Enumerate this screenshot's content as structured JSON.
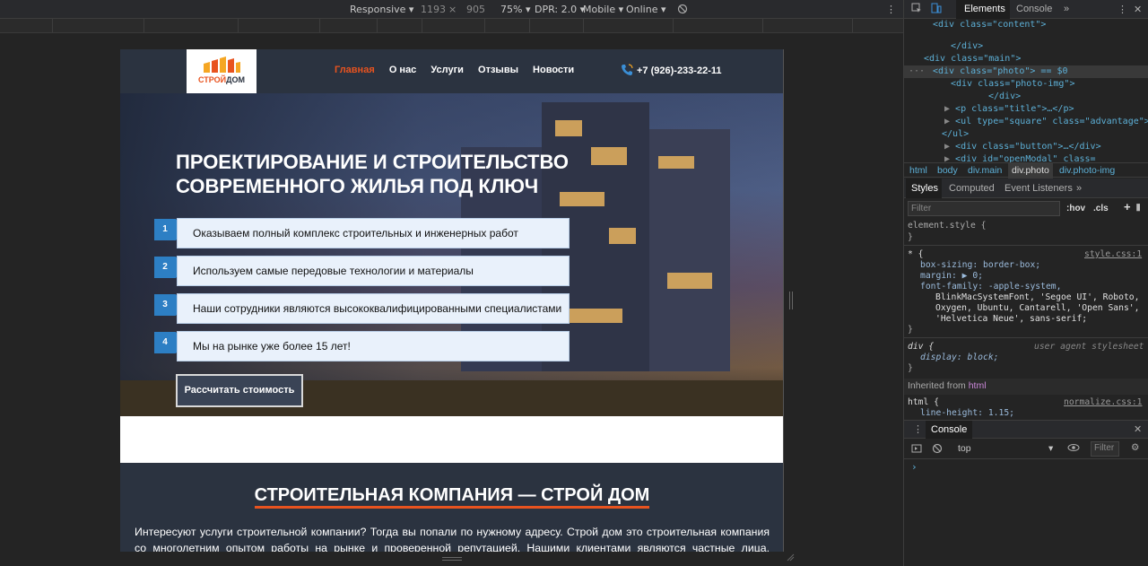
{
  "toolbar": {
    "device": "Responsive",
    "width": "1193",
    "times": "×",
    "height": "905",
    "zoom": "75%",
    "dpr": "DPR: 2.0",
    "mode": "Mobile",
    "network": "Online"
  },
  "site": {
    "logo_top": "СТРОЙ",
    "logo_bottom": "ДОМ",
    "nav": [
      "Главная",
      "О нас",
      "Услуги",
      "Отзывы",
      "Новости"
    ],
    "phone": "+7 (926)-233-22-11",
    "hero_title_line1": "ПРОЕКТИРОВАНИЕ И СТРОИТЕЛЬСТВО",
    "hero_title_line2": "СОВРЕМЕННОГО ЖИЛЬЯ ПОД КЛЮЧ",
    "advantages": [
      {
        "num": "1",
        "text": "Оказываем полный комплекс строительных и инженерных работ"
      },
      {
        "num": "2",
        "text": "Используем самые передовые технологии и материалы"
      },
      {
        "num": "3",
        "text": "Наши сотрудники являются высококвалифицированными специалистами"
      },
      {
        "num": "4",
        "text": "Мы на рынке уже более 15 лет!"
      }
    ],
    "calc_button": "Рассчитать стоимость",
    "section_title": "СТРОИТЕЛЬНАЯ КОМПАНИЯ — СТРОЙ ДОМ",
    "section_text": "Интересуют услуги строительной компании? Тогда вы попали по нужному адресу. Строй дом это строительная компания со многолетним опытом работы на рынке и проверенной репутацией. Нашими клиентами являются частные лица, небольшие"
  },
  "devtools": {
    "tabs": [
      "Elements",
      "Console"
    ],
    "dom_lines": [
      "<div class=\"content\">",
      "</div>",
      "<div class=\"main\">",
      "<div class=\"photo\"> == $0",
      "<div class=\"photo-img\">",
      "</div>",
      "<p class=\"title\">…</p>",
      "<ul type=\"square\" class=\"advantage\">",
      "</ul>",
      "<div class=\"button\">…</div>",
      "<div id=\"openModal\" class="
    ],
    "breadcrumbs": [
      "html",
      "body",
      "div.main",
      "div.photo",
      "div.photo-img"
    ],
    "style_tabs": [
      "Styles",
      "Computed",
      "Event Listeners"
    ],
    "filter_placeholder": "Filter",
    "hov": ":hov",
    "cls": ".cls",
    "element_style": "element.style {",
    "close_brace": "}",
    "rule_star": "* {",
    "src_style": "style.css:1",
    "box_sizing": "box-sizing: border-box;",
    "margin": "margin: ▶ 0;",
    "font_family_1": "font-family: -apple-system,",
    "font_family_2": "BlinkMacSystemFont, 'Segoe UI', Roboto,",
    "font_family_3": "Oxygen, Ubuntu, Cantarell, 'Open Sans',",
    "font_family_4": "'Helvetica Neue', sans-serif;",
    "div_rule": "div {",
    "ua_stylesheet": "user agent stylesheet",
    "display": "display: block;",
    "inherited_label": "Inherited from",
    "inherited_tag": "html",
    "html_rule": "html {",
    "src_normalize": "normalize.css:1",
    "line_height": "line-height: 1.15;",
    "console_tab": "Console",
    "console_context": "top",
    "console_filter": "Filter",
    "console_prompt": "›"
  }
}
